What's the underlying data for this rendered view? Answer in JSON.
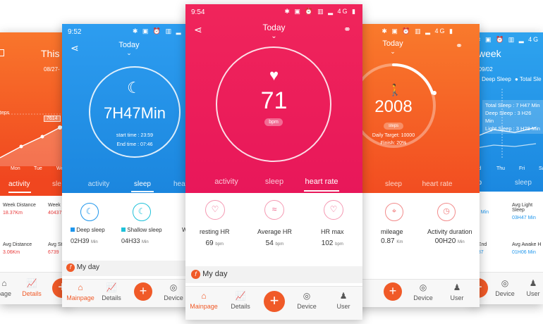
{
  "colors": {
    "orange": "#f45b2c",
    "blue": "#1f96ec",
    "red": "#ee1f5e",
    "accent": "#f05a28"
  },
  "p1": {
    "title": "This w",
    "date": "08/27-",
    "chart_label": "teps",
    "chart_value": "7614",
    "days": [
      "Mon",
      "Tue",
      "We"
    ],
    "tab_activity": "activity",
    "tab_next": "sle",
    "stats": [
      {
        "label": "Week Distance",
        "value": "18.37Km"
      },
      {
        "label": "Week S",
        "value": "40437"
      },
      {
        "label": "Avg Distance",
        "value": "3.06Km"
      },
      {
        "label": "Avg St",
        "value": "6739"
      }
    ],
    "nav_mainpage": "page",
    "nav_details": "Details"
  },
  "p2": {
    "time": "9:52",
    "status_icons": "✱ ▣ ⏰ ▥ ▂ ▮",
    "title": "Today",
    "duration": "7H47Min",
    "start_label": "start time :",
    "start_value": "23:59",
    "end_label": "End time :",
    "end_value": "07:46",
    "tabs": [
      "activity",
      "sleep",
      "hear"
    ],
    "stats": [
      {
        "label": "Deep sleep",
        "value": "02H39",
        "unit": "Min"
      },
      {
        "label": "Shallow sleep",
        "value": "04H33",
        "unit": "Min"
      },
      {
        "label": "W",
        "value": "",
        "unit": ""
      }
    ],
    "my_day": "My day",
    "nav": [
      "Mainpage",
      "Details",
      "Device"
    ]
  },
  "p3": {
    "time": "9:54",
    "status_icons": "✱ ▣ ⏰ ▥ ▂ 4G ▮",
    "title": "Today",
    "heart_rate": "71",
    "unit": "bpm",
    "tabs": [
      "activity",
      "sleep",
      "heart rate"
    ],
    "stats": [
      {
        "label": "resting HR",
        "value": "69",
        "unit": "bpm"
      },
      {
        "label": "Average HR",
        "value": "54",
        "unit": "bpm"
      },
      {
        "label": "HR max",
        "value": "102",
        "unit": "bpm"
      }
    ],
    "my_day": "My day",
    "nav": [
      "Mainpage",
      "Details",
      "Device",
      "User"
    ]
  },
  "p4": {
    "status_icons": "✱ ▣ ⏰ ▥ ▂ 4G ▮",
    "title": "Today",
    "steps": "2008",
    "steps_unit": "steps",
    "target": "Daily Target: 10000",
    "finish": "Finish: 20%",
    "progress": 0.2,
    "tabs": [
      "sleep",
      "heart rate"
    ],
    "stats": [
      {
        "label": "mileage",
        "value": "0.87",
        "unit": "Km"
      },
      {
        "label": "Activity duration",
        "value": "00H20",
        "unit": "Min"
      }
    ],
    "nav": [
      "Device",
      "User"
    ]
  },
  "p5": {
    "status_icons": "✱ ▣ ⏰ ▥ ▂ 4G",
    "title": "week",
    "date": "-09/02",
    "legend": [
      "Deep Sleep",
      "Total Sle"
    ],
    "tip": [
      "Total Sleep : 7 H47 Min",
      "Deep Sleep : 3 H26 Min",
      "Light Sleep : 3 H28 Min"
    ],
    "days": [
      "red",
      "Thu",
      "Fri",
      "Sa"
    ],
    "tab": "sleep",
    "tab_left": "ep",
    "stats": [
      {
        "label": "Avg Light Sleep",
        "value": "03H47 Min"
      },
      {
        "label": "",
        "value": "55 Min"
      },
      {
        "label": "Avg Awake H",
        "value": "01H06 Min"
      },
      {
        "label": "p End",
        "value": "7:37"
      }
    ],
    "nav": [
      "Device",
      "User"
    ]
  }
}
